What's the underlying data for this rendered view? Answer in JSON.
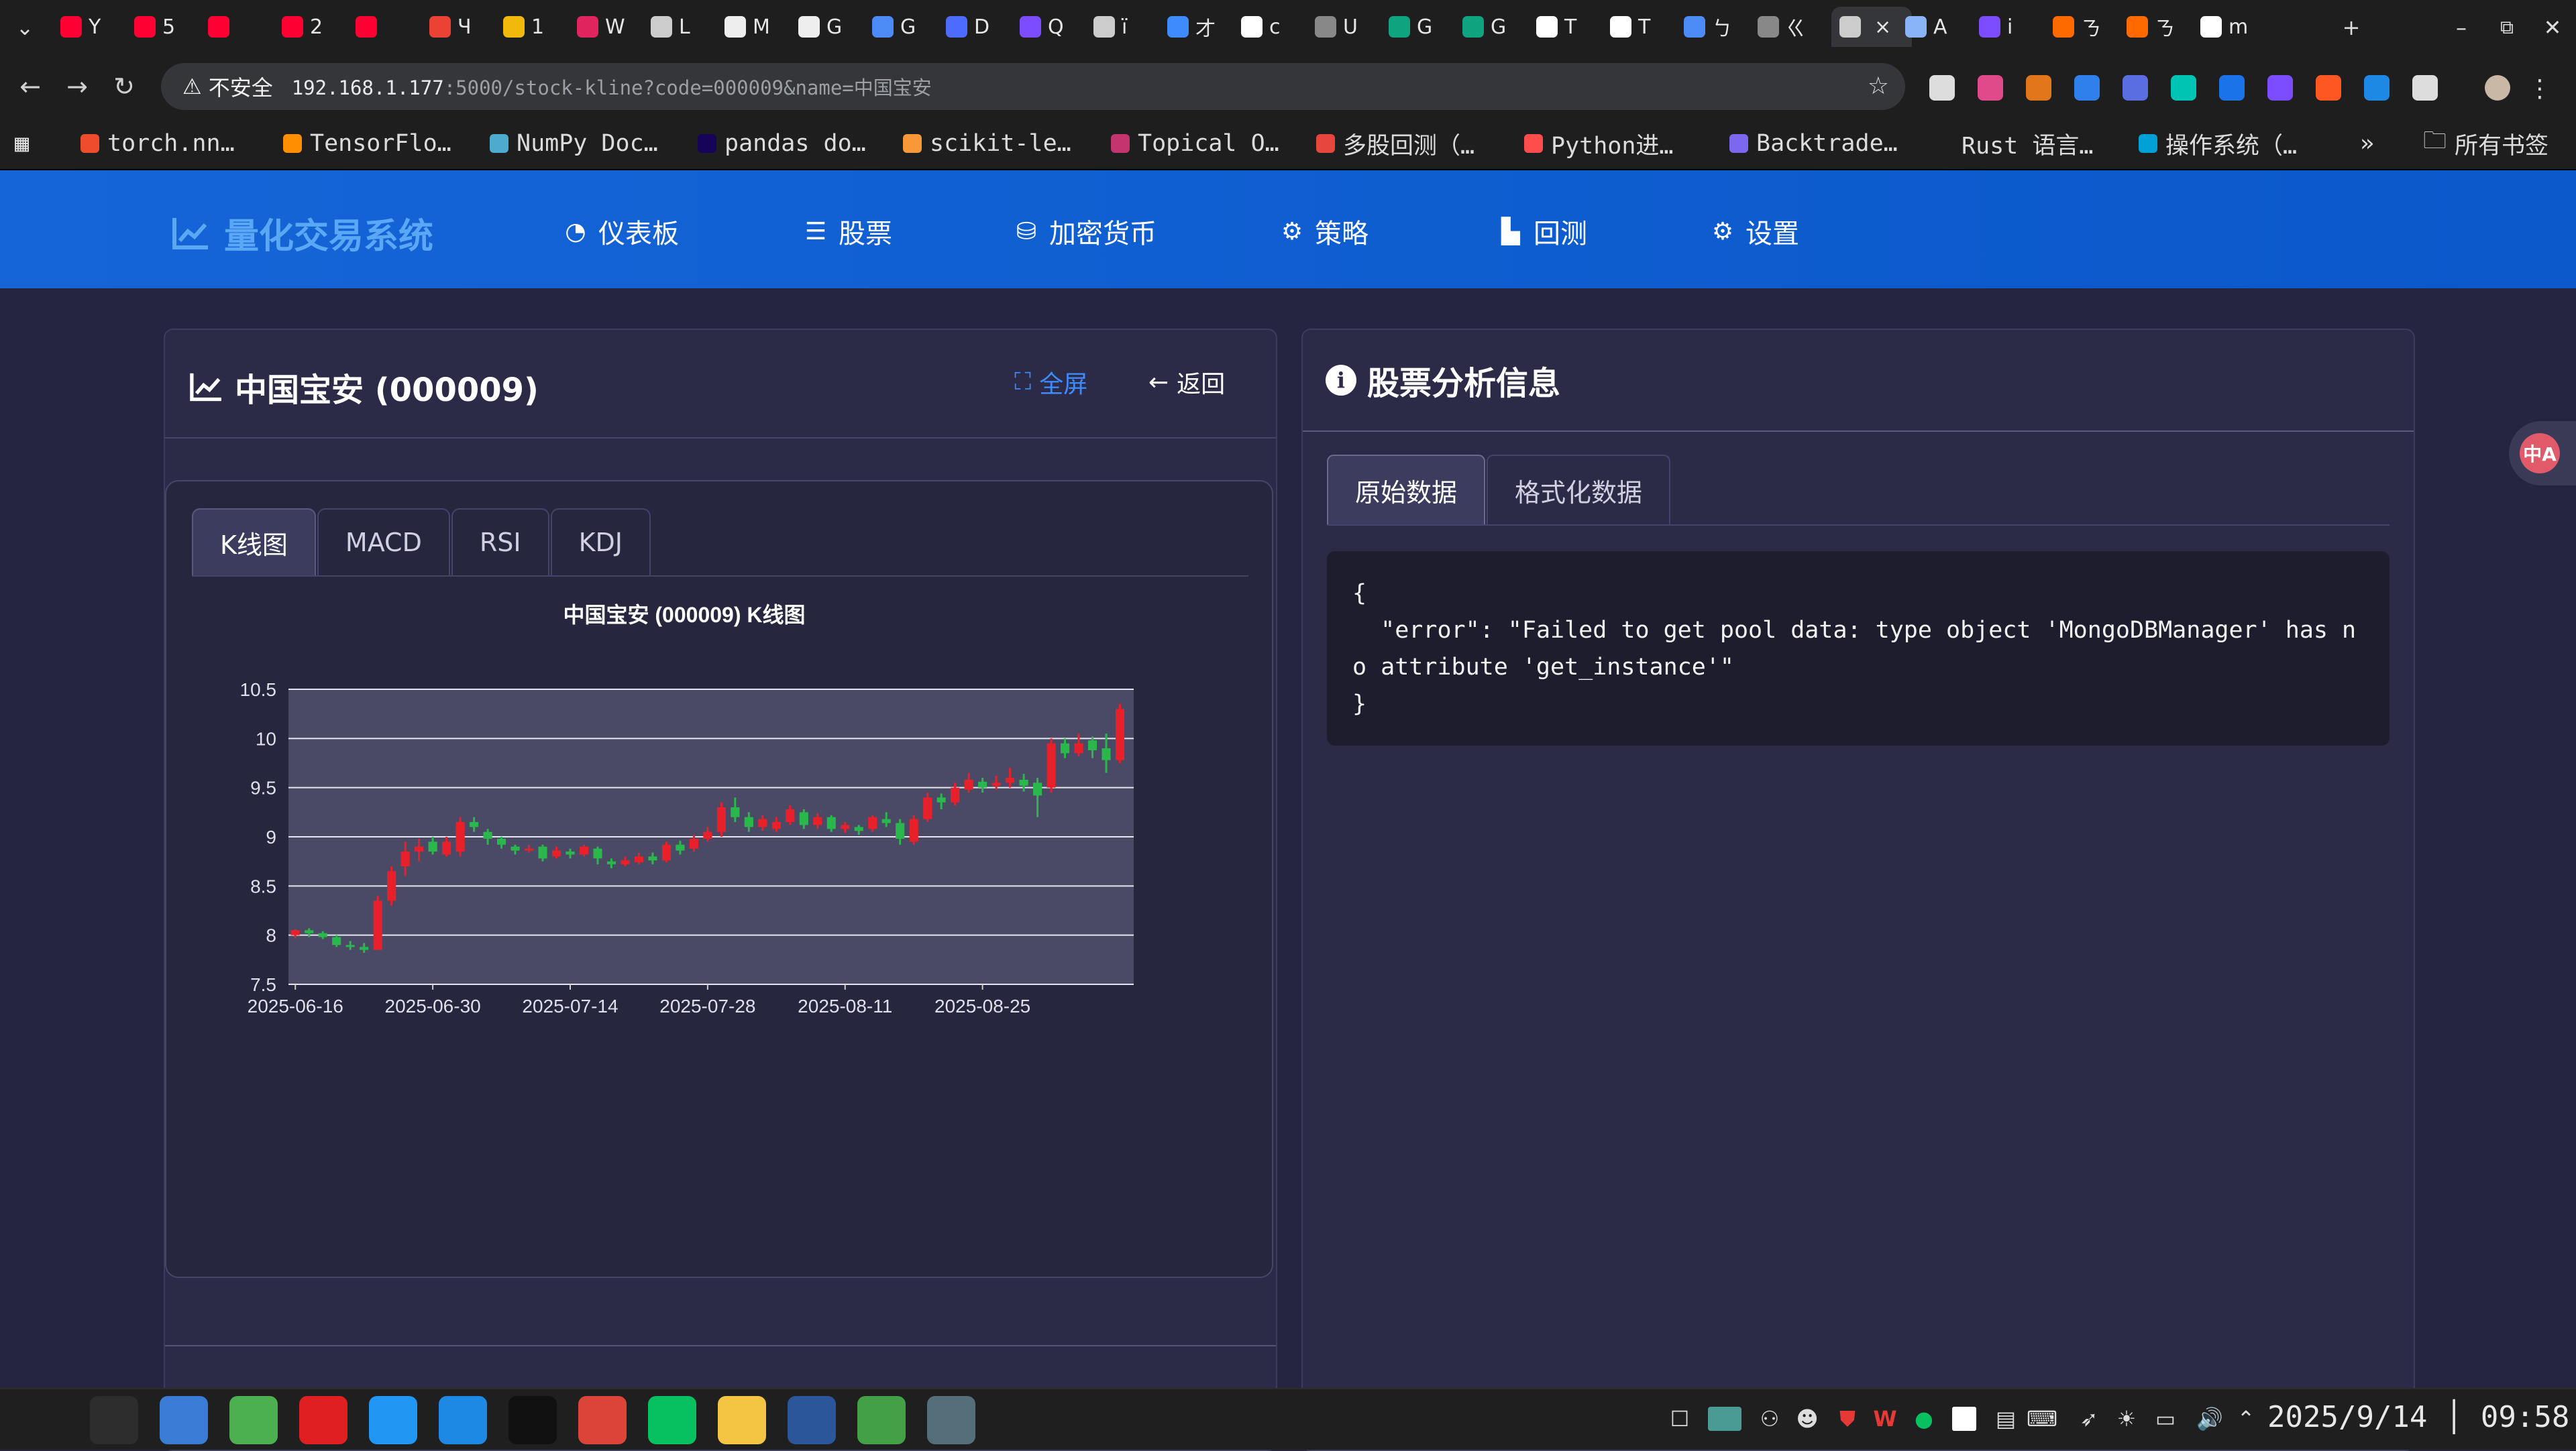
{
  "browser": {
    "tabs": [
      {
        "label": "Y",
        "color": "#ff0033"
      },
      {
        "label": "5",
        "color": "#ff0033"
      },
      {
        "label": "",
        "color": "#ff0033"
      },
      {
        "label": "2",
        "color": "#ff0033"
      },
      {
        "label": "",
        "color": "#ff0033"
      },
      {
        "label": "Ч",
        "color": "#ea4335"
      },
      {
        "label": "1",
        "color": "#f0b90b"
      },
      {
        "label": "W",
        "color": "#e0245e"
      },
      {
        "label": "L",
        "color": "#cccccc"
      },
      {
        "label": "M",
        "color": "#eeeeee"
      },
      {
        "label": "G",
        "color": "#eeeeee"
      },
      {
        "label": "G",
        "color": "#4c8bf5"
      },
      {
        "label": "D",
        "color": "#4d6bfe"
      },
      {
        "label": "Q",
        "color": "#7c4dff"
      },
      {
        "label": "ï",
        "color": "#cccccc"
      },
      {
        "label": "才",
        "color": "#3d8bfd"
      },
      {
        "label": "c",
        "color": "#ffffff"
      },
      {
        "label": "U",
        "color": "#888888"
      },
      {
        "label": "G",
        "color": "#10a37f"
      },
      {
        "label": "G",
        "color": "#10a37f"
      },
      {
        "label": "T",
        "color": "#ffffff"
      },
      {
        "label": "T",
        "color": "#ffffff"
      },
      {
        "label": "ㄅ",
        "color": "#4c8bf5"
      },
      {
        "label": "ㄍ",
        "color": "#888888"
      },
      {
        "label": "",
        "color": "#cccccc"
      },
      {
        "label": "A",
        "color": "#8ab4f8"
      },
      {
        "label": "i",
        "color": "#7c4dff"
      },
      {
        "label": "ㄋ",
        "color": "#ff6a00"
      },
      {
        "label": "ㄋ",
        "color": "#ff6a00"
      },
      {
        "label": "m",
        "color": "#ffffff"
      }
    ],
    "new_tab": "+",
    "close_tab": "×",
    "security_label": "不安全",
    "url_host": "192.168.1.177",
    "url_rest": ":5000/stock-kline?code=000009&name=中国宝安",
    "bookmarks": [
      {
        "label": "torch.nn…",
        "color": "#ee4c2c"
      },
      {
        "label": "TensorFlo…",
        "color": "#ff8f00"
      },
      {
        "label": "NumPy Doc…",
        "color": "#4dabcf"
      },
      {
        "label": "pandas do…",
        "color": "#150458"
      },
      {
        "label": "scikit-le…",
        "color": "#f89939"
      },
      {
        "label": "Topical O…",
        "color": "#c4346f"
      },
      {
        "label": "多股回测（…",
        "color": "#e8453c"
      },
      {
        "label": "Python进…",
        "color": "#ff4d4d"
      },
      {
        "label": "Backtrade…",
        "color": "#7b68ee"
      },
      {
        "label": "Rust 语言…",
        "color": "#1e1e1e"
      },
      {
        "label": "操作系统（…",
        "color": "#00a1d6"
      }
    ],
    "bookmarks_more": "»",
    "all_bookmarks": "所有书签"
  },
  "app": {
    "brand": "量化交易系统",
    "nav": [
      {
        "label": "仪表板",
        "icon": "dashboard-icon"
      },
      {
        "label": "股票",
        "icon": "list-icon"
      },
      {
        "label": "加密货币",
        "icon": "coins-icon"
      },
      {
        "label": "策略",
        "icon": "gears-icon"
      },
      {
        "label": "回测",
        "icon": "bar-chart-icon"
      },
      {
        "label": "设置",
        "icon": "gear-icon"
      }
    ]
  },
  "stock_panel": {
    "title": "中国宝安 (000009)",
    "fullscreen_label": "全屏",
    "back_label": "返回",
    "chart_tabs": [
      "K线图",
      "MACD",
      "RSI",
      "KDJ"
    ]
  },
  "info_panel": {
    "title": "股票分析信息",
    "tabs": [
      "原始数据",
      "格式化数据"
    ],
    "raw_json": "{\n  \"error\": \"Failed to get pool data: type object 'MongoDBManager' has no attribute 'get_instance'\"\n}"
  },
  "chart_data": {
    "type": "candlestick",
    "title": "中国宝安 (000009) K线图",
    "xlabel": "",
    "ylabel": "",
    "ylim": [
      7.5,
      10.5
    ],
    "yticks": [
      7.5,
      8,
      8.5,
      9,
      9.5,
      10,
      10.5
    ],
    "xticks": [
      "2025-06-16",
      "2025-06-30",
      "2025-07-14",
      "2025-07-28",
      "2025-08-11",
      "2025-08-25"
    ],
    "grid": true,
    "up_color": "#e8202a",
    "down_color": "#2ab84c",
    "candles": [
      [
        "2025-06-16",
        8.0,
        8.05,
        7.97,
        8.06
      ],
      [
        "2025-06-17",
        8.05,
        8.02,
        7.98,
        8.07
      ],
      [
        "2025-06-18",
        8.02,
        7.98,
        7.96,
        8.04
      ],
      [
        "2025-06-19",
        7.98,
        7.9,
        7.88,
        8.0
      ],
      [
        "2025-06-20",
        7.9,
        7.88,
        7.85,
        7.94
      ],
      [
        "2025-06-23",
        7.88,
        7.85,
        7.82,
        7.92
      ],
      [
        "2025-06-24",
        7.85,
        8.35,
        7.85,
        8.4
      ],
      [
        "2025-06-25",
        8.35,
        8.65,
        8.3,
        8.7
      ],
      [
        "2025-06-26",
        8.7,
        8.85,
        8.6,
        8.95
      ],
      [
        "2025-06-27",
        8.85,
        8.9,
        8.75,
        8.98
      ],
      [
        "2025-06-30",
        8.95,
        8.85,
        8.82,
        9.0
      ],
      [
        "2025-07-01",
        8.82,
        8.95,
        8.8,
        9.0
      ],
      [
        "2025-07-02",
        8.85,
        9.15,
        8.8,
        9.2
      ],
      [
        "2025-07-03",
        9.15,
        9.1,
        9.05,
        9.2
      ],
      [
        "2025-07-04",
        9.05,
        8.98,
        8.92,
        9.08
      ],
      [
        "2025-07-07",
        8.98,
        8.92,
        8.88,
        9.0
      ],
      [
        "2025-07-08",
        8.9,
        8.86,
        8.82,
        8.92
      ],
      [
        "2025-07-09",
        8.86,
        8.88,
        8.84,
        8.92
      ],
      [
        "2025-07-10",
        8.9,
        8.78,
        8.75,
        8.92
      ],
      [
        "2025-07-11",
        8.8,
        8.86,
        8.78,
        8.9
      ],
      [
        "2025-07-14",
        8.85,
        8.82,
        8.78,
        8.88
      ],
      [
        "2025-07-15",
        8.82,
        8.9,
        8.8,
        8.92
      ],
      [
        "2025-07-16",
        8.88,
        8.78,
        8.72,
        8.9
      ],
      [
        "2025-07-17",
        8.75,
        8.72,
        8.68,
        8.78
      ],
      [
        "2025-07-18",
        8.72,
        8.76,
        8.7,
        8.8
      ],
      [
        "2025-07-21",
        8.74,
        8.8,
        8.72,
        8.84
      ],
      [
        "2025-07-22",
        8.8,
        8.76,
        8.72,
        8.84
      ],
      [
        "2025-07-23",
        8.76,
        8.92,
        8.74,
        8.95
      ],
      [
        "2025-07-24",
        8.92,
        8.86,
        8.82,
        8.96
      ],
      [
        "2025-07-25",
        8.88,
        8.98,
        8.85,
        9.02
      ],
      [
        "2025-07-28",
        8.98,
        9.05,
        8.95,
        9.1
      ],
      [
        "2025-07-29",
        9.05,
        9.3,
        9.0,
        9.35
      ],
      [
        "2025-07-30",
        9.3,
        9.2,
        9.15,
        9.4
      ],
      [
        "2025-07-31",
        9.2,
        9.1,
        9.05,
        9.25
      ],
      [
        "2025-08-01",
        9.1,
        9.18,
        9.06,
        9.22
      ],
      [
        "2025-08-04",
        9.08,
        9.15,
        9.05,
        9.2
      ],
      [
        "2025-08-05",
        9.15,
        9.28,
        9.12,
        9.32
      ],
      [
        "2025-08-06",
        9.25,
        9.12,
        9.08,
        9.28
      ],
      [
        "2025-08-07",
        9.12,
        9.2,
        9.08,
        9.24
      ],
      [
        "2025-08-08",
        9.2,
        9.08,
        9.05,
        9.22
      ],
      [
        "2025-08-11",
        9.08,
        9.12,
        9.04,
        9.15
      ],
      [
        "2025-08-12",
        9.1,
        9.06,
        9.02,
        9.12
      ],
      [
        "2025-08-13",
        9.08,
        9.2,
        9.05,
        9.22
      ],
      [
        "2025-08-14",
        9.18,
        9.14,
        9.1,
        9.25
      ],
      [
        "2025-08-15",
        9.14,
        8.98,
        8.92,
        9.18
      ],
      [
        "2025-08-18",
        8.95,
        9.18,
        8.92,
        9.22
      ],
      [
        "2025-08-19",
        9.18,
        9.4,
        9.15,
        9.45
      ],
      [
        "2025-08-20",
        9.4,
        9.35,
        9.28,
        9.44
      ],
      [
        "2025-08-21",
        9.35,
        9.5,
        9.32,
        9.55
      ],
      [
        "2025-08-22",
        9.48,
        9.58,
        9.45,
        9.65
      ],
      [
        "2025-08-25",
        9.56,
        9.5,
        9.45,
        9.6
      ],
      [
        "2025-08-26",
        9.52,
        9.55,
        9.48,
        9.62
      ],
      [
        "2025-08-27",
        9.55,
        9.6,
        9.5,
        9.7
      ],
      [
        "2025-08-28",
        9.58,
        9.52,
        9.46,
        9.64
      ],
      [
        "2025-08-29",
        9.55,
        9.42,
        9.2,
        9.6
      ],
      [
        "2025-09-01",
        9.5,
        9.95,
        9.45,
        10.0
      ],
      [
        "2025-09-02",
        9.95,
        9.85,
        9.8,
        10.0
      ],
      [
        "2025-09-03",
        9.85,
        9.95,
        9.82,
        10.05
      ],
      [
        "2025-09-04",
        9.98,
        9.88,
        9.8,
        10.02
      ],
      [
        "2025-09-05",
        9.9,
        9.78,
        9.65,
        10.05
      ],
      [
        "2025-09-08",
        9.78,
        10.3,
        9.75,
        10.35
      ]
    ]
  },
  "taskbar": {
    "apps": [
      {
        "name": "launcher",
        "color": "#3a3a3a"
      },
      {
        "name": "terminal",
        "color": "#2d2d2d"
      },
      {
        "name": "deepin-store",
        "color": "#3a7bd5"
      },
      {
        "name": "downloader",
        "color": "#4caf50"
      },
      {
        "name": "music",
        "color": "#e02020"
      },
      {
        "name": "todo",
        "color": "#2196f3"
      },
      {
        "name": "mail",
        "color": "#1e88e5"
      },
      {
        "name": "qq",
        "color": "#111111"
      },
      {
        "name": "chrome",
        "color": "#db4437"
      },
      {
        "name": "wechat",
        "color": "#07c160"
      },
      {
        "name": "baidu-netdisk",
        "color": "#f4c542"
      },
      {
        "name": "word",
        "color": "#2b579a"
      },
      {
        "name": "rocket",
        "color": "#43a047"
      },
      {
        "name": "screenshot",
        "color": "#546e7a"
      }
    ],
    "date": "2025/9/14",
    "time": "09:58"
  }
}
